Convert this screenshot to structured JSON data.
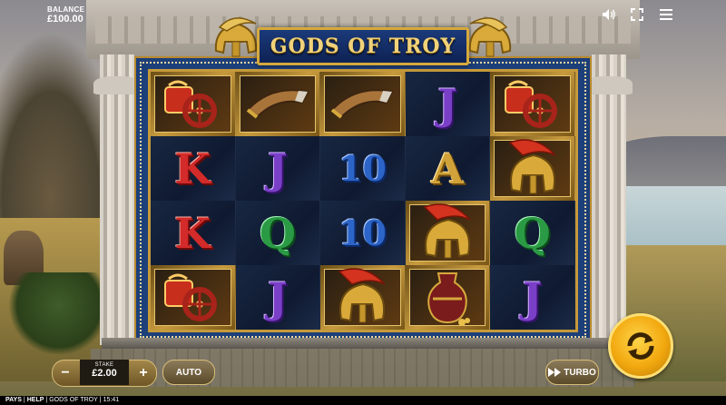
{
  "game": {
    "title": "GODS OF TROY"
  },
  "balance": {
    "label": "BALANCE",
    "value": "£100.00"
  },
  "top_icons": [
    "speaker-icon",
    "fullscreen-icon",
    "menu-icon"
  ],
  "reels": [
    [
      "chariot",
      "K",
      "K",
      "chariot"
    ],
    [
      "horn",
      "J",
      "Q",
      "J"
    ],
    [
      "horn",
      "10",
      "10",
      "helmet"
    ],
    [
      "J",
      "A",
      "helmet",
      "vase"
    ],
    [
      "chariot",
      "helmet",
      "Q",
      "J"
    ]
  ],
  "controls": {
    "stake_label": "STAKE",
    "stake_value": "£2.00",
    "minus": "−",
    "plus": "+",
    "auto": "AUTO",
    "turbo": "TURBO"
  },
  "footer": {
    "pays": "PAYS",
    "help": "HELP",
    "game_name": "GODS OF TROY",
    "time": "15:41"
  },
  "colors": {
    "accent_gold": "#d6a93c",
    "spin_yellow": "#f2a80f",
    "logo_blue": "#1b3a7a"
  }
}
